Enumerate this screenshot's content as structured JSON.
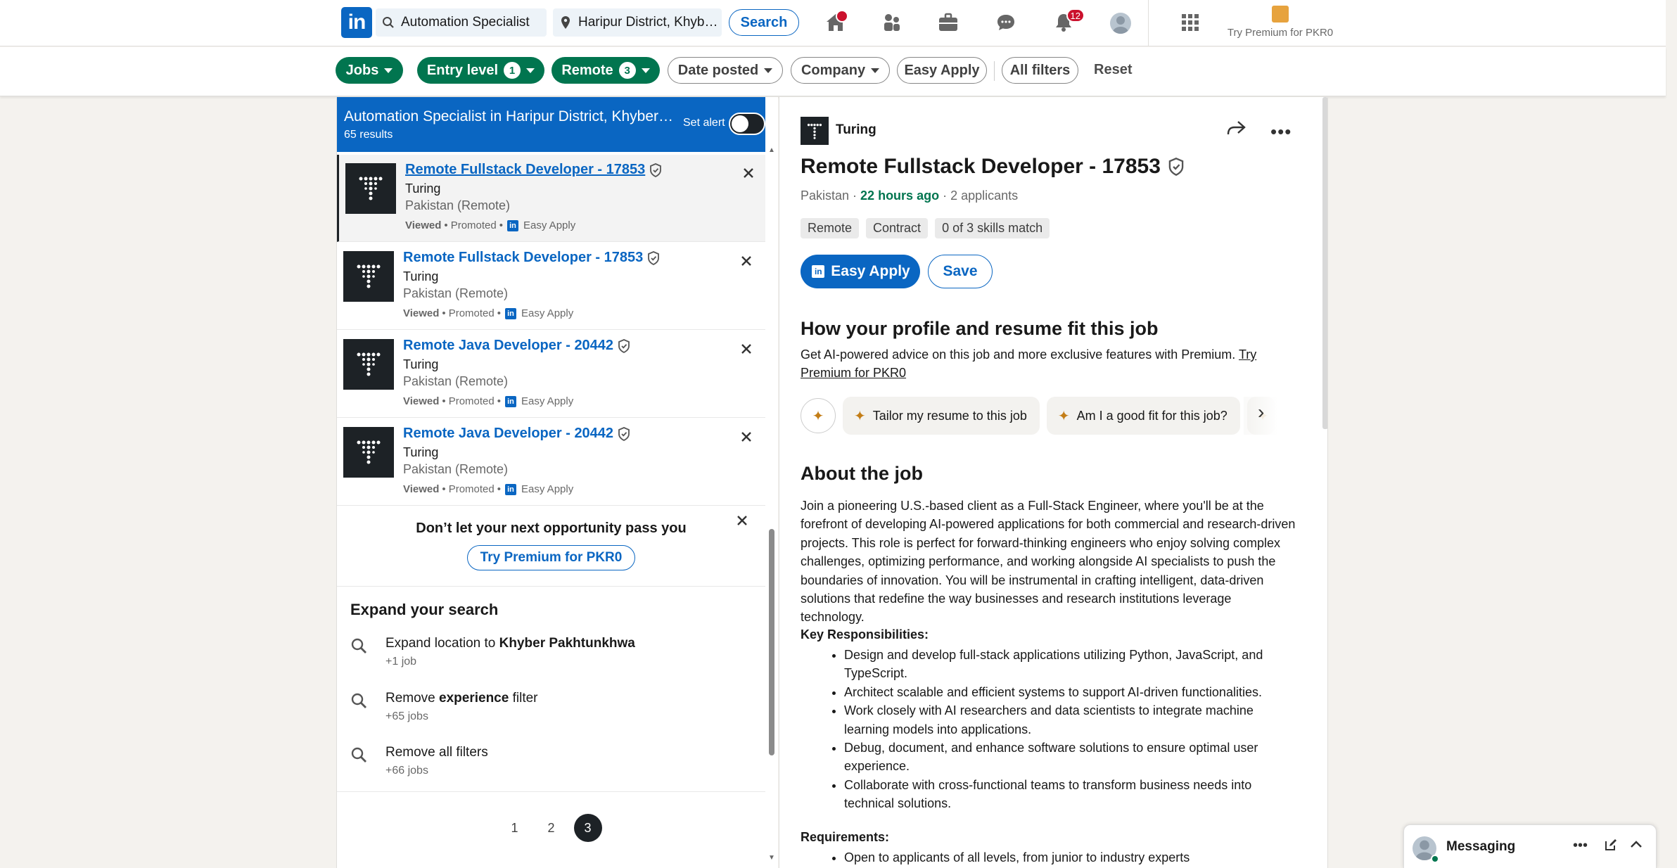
{
  "nav": {
    "logo": "in",
    "search_keywords": "Automation Specialist",
    "search_location": "Haripur District, Khyber...",
    "search_button": "Search",
    "notifications_count": "12",
    "premium_label": "Try Premium for PKR0"
  },
  "filters": {
    "jobs": "Jobs",
    "entry_level": "Entry level",
    "entry_level_count": "1",
    "remote": "Remote",
    "remote_count": "3",
    "date_posted": "Date posted",
    "company": "Company",
    "easy_apply": "Easy Apply",
    "all_filters": "All filters",
    "reset": "Reset"
  },
  "list": {
    "title": "Automation Specialist in Haripur District, Khyber Pakhtunkhwa, Pakistan",
    "results": "65 results",
    "set_alert": "Set alert",
    "jobs": [
      {
        "title": "Remote Fullstack Developer - 17853",
        "company": "Turing",
        "location": "Pakistan (Remote)",
        "viewed": "Viewed",
        "promoted": "Promoted",
        "easy_apply": "Easy Apply"
      },
      {
        "title": "Remote Fullstack Developer - 17853",
        "company": "Turing",
        "location": "Pakistan (Remote)",
        "viewed": "Viewed",
        "promoted": "Promoted",
        "easy_apply": "Easy Apply"
      },
      {
        "title": "Remote Java Developer - 20442",
        "company": "Turing",
        "location": "Pakistan (Remote)",
        "viewed": "Viewed",
        "promoted": "Promoted",
        "easy_apply": "Easy Apply"
      },
      {
        "title": "Remote Java Developer - 20442",
        "company": "Turing",
        "location": "Pakistan (Remote)",
        "viewed": "Viewed",
        "promoted": "Promoted",
        "easy_apply": "Easy Apply"
      }
    ],
    "promo_heading": "Don’t let your next opportunity pass you",
    "promo_button": "Try Premium for PKR0",
    "expand_heading": "Expand your search",
    "expand_items": [
      {
        "pre": "Expand location to ",
        "bold": "Khyber Pakhtunkhwa",
        "post": "",
        "sub": "+1 job"
      },
      {
        "pre": "Remove ",
        "bold": "experience",
        "post": " filter",
        "sub": "+65 jobs"
      },
      {
        "pre": "Remove all filters",
        "bold": "",
        "post": "",
        "sub": "+66 jobs"
      }
    ],
    "pages": [
      "1",
      "2",
      "3"
    ],
    "current_page": "3"
  },
  "detail": {
    "company": "Turing",
    "title": "Remote Fullstack Developer - 17853",
    "location": "Pakistan",
    "posted": "22 hours ago",
    "applicants": "2 applicants",
    "chips": [
      "Remote",
      "Contract",
      "0 of 3 skills match"
    ],
    "apply_button": "Easy Apply",
    "save_button": "Save",
    "fit_heading": "How your profile and resume fit this job",
    "fit_text": "Get AI-powered advice on this job and more exclusive features with Premium.",
    "fit_link": "Try Premium for PKR0",
    "ai_chips": [
      "Tailor my resume to this job",
      "Am I a good fit for this job?"
    ],
    "about_heading": "About the job",
    "about_text": "Join a pioneering U.S.-based client as a Full-Stack Engineer, where you'll be at the forefront of developing AI-powered applications for both commercial and research-driven projects. This role is perfect for forward-thinking engineers who enjoy solving complex challenges, optimizing performance, and working alongside AI specialists to push the boundaries of innovation. You will be instrumental in crafting intelligent, data-driven solutions that redefine the way businesses and research institutions leverage technology.",
    "responsibilities_heading": "Key Responsibilities:",
    "responsibilities": [
      "Design and develop full-stack applications utilizing Python, JavaScript, and TypeScript.",
      "Architect scalable and efficient systems to support AI-driven functionalities.",
      "Work closely with AI researchers and data scientists to integrate machine learning models into applications.",
      "Debug, document, and enhance software solutions to ensure optimal user experience.",
      "Collaborate with cross-functional teams to transform business needs into technical solutions."
    ],
    "requirements_heading": "Requirements:",
    "requirements": [
      "Open to applicants of all levels, from junior to industry experts"
    ]
  },
  "messaging": {
    "label": "Messaging"
  },
  "colors": {
    "brand": "#0a66c2",
    "filter_active": "#01754f",
    "badge": "#cb112d"
  }
}
